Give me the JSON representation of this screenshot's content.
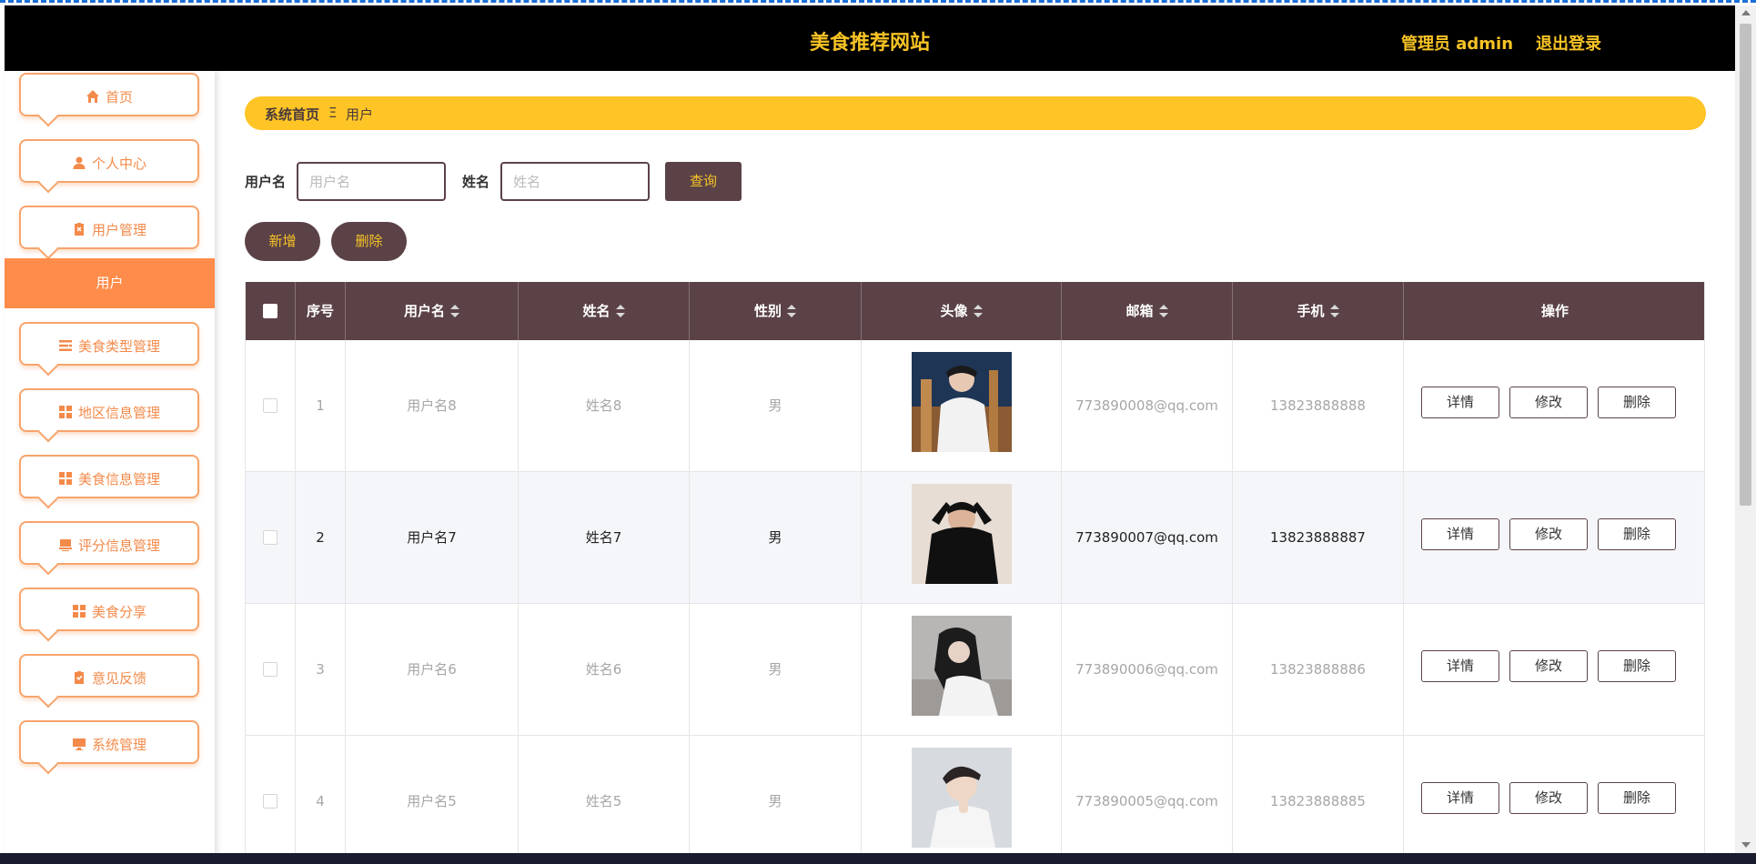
{
  "header": {
    "site_title": "美食推荐网站",
    "admin_label": "管理员 admin",
    "logout_label": "退出登录",
    "accent_color": "#f7c325",
    "bg_color": "#000000"
  },
  "sidebar": {
    "items": [
      {
        "label": "首页",
        "icon": "home-icon"
      },
      {
        "label": "个人中心",
        "icon": "user-icon"
      },
      {
        "label": "用户管理",
        "icon": "clipboard-icon"
      },
      {
        "label": "美食类型管理",
        "icon": "list-icon"
      },
      {
        "label": "地区信息管理",
        "icon": "grid-icon"
      },
      {
        "label": "美食信息管理",
        "icon": "grid-icon"
      },
      {
        "label": "评分信息管理",
        "icon": "tray-icon"
      },
      {
        "label": "美食分享",
        "icon": "grid-icon"
      },
      {
        "label": "意见反馈",
        "icon": "clipboard-check-icon"
      },
      {
        "label": "系统管理",
        "icon": "monitor-icon"
      }
    ],
    "active_sub_item": "用户",
    "accent_color": "#ff8c4a"
  },
  "breadcrumb": {
    "home": "系统首页",
    "separator": "Ξ",
    "current": "用户"
  },
  "search": {
    "username_label": "用户名",
    "username_placeholder": "用户名",
    "name_label": "姓名",
    "name_placeholder": "姓名",
    "query_label": "查询"
  },
  "actions": {
    "add_label": "新增",
    "delete_label": "删除"
  },
  "table": {
    "columns": [
      "序号",
      "用户名",
      "姓名",
      "性别",
      "头像",
      "邮箱",
      "手机",
      "操作"
    ],
    "row_actions": {
      "detail": "详情",
      "edit": "修改",
      "delete": "删除"
    },
    "rows": [
      {
        "index": "1",
        "username": "用户名8",
        "name": "姓名8",
        "gender": "男",
        "email": "773890008@qq.com",
        "phone": "13823888888"
      },
      {
        "index": "2",
        "username": "用户名7",
        "name": "姓名7",
        "gender": "男",
        "email": "773890007@qq.com",
        "phone": "13823888887"
      },
      {
        "index": "3",
        "username": "用户名6",
        "name": "姓名6",
        "gender": "男",
        "email": "773890006@qq.com",
        "phone": "13823888886"
      },
      {
        "index": "4",
        "username": "用户名5",
        "name": "姓名5",
        "gender": "男",
        "email": "773890005@qq.com",
        "phone": "13823888885"
      }
    ],
    "header_color": "#5b4247"
  }
}
